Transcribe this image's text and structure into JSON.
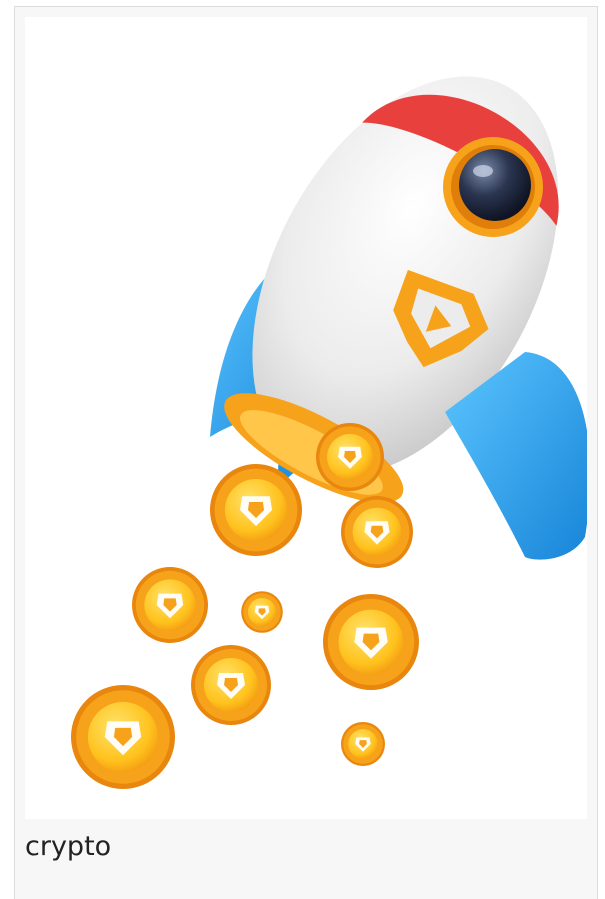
{
  "card": {
    "caption": "crypto"
  },
  "image": {
    "subject": "rocket-with-coins-illustration",
    "colors": {
      "rocket_body": "#eeeeee",
      "rocket_nose": "#e8413d",
      "fins": "#29a6ee",
      "coin": "#f7a21b",
      "coin_face": "#ffd23a",
      "logo": "#f7a21b"
    }
  }
}
